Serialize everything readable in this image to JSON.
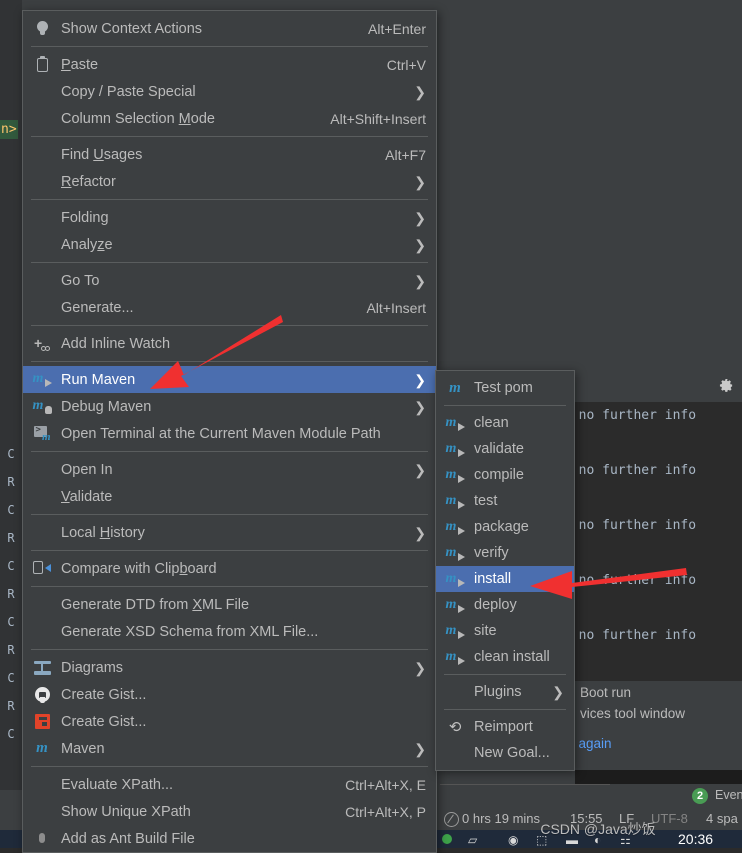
{
  "background": {
    "gutter_marks": [
      "C",
      "R",
      "C",
      "R",
      "C",
      "R",
      "C",
      "R",
      "C",
      "R",
      "C"
    ],
    "code_token": "n>",
    "console_lines": [
      ": no further info",
      ": no further info",
      ": no further info",
      ": no further info",
      ": no further info"
    ],
    "console_footer": {
      "line1": "Boot run",
      "line2": "vices tool window",
      "line3": ": again"
    },
    "gear_icon": "gear-icon"
  },
  "event_strip": {
    "badge_count": "2",
    "label": "Even"
  },
  "status_bar": {
    "clock_icon": "clock-icon",
    "elapsed": "0 hrs 19 mins",
    "time": "15:55",
    "line_separator": "LF",
    "encoding": "UTF-8",
    "indent": "4 spa"
  },
  "taskbar": {
    "clock": "20:36"
  },
  "watermark": "CSDN @Java炒饭",
  "context_menu": {
    "items": [
      {
        "type": "item",
        "label": "Show Context Actions",
        "shortcut": "Alt+Enter",
        "icon": "lightbulb-icon",
        "name": "menu-item-show-context-actions"
      },
      {
        "type": "separator"
      },
      {
        "type": "item",
        "label": "Paste",
        "mnemonic": "P",
        "shortcut": "Ctrl+V",
        "icon": "clipboard-icon",
        "name": "menu-item-paste"
      },
      {
        "type": "item",
        "label": "Copy / Paste Special",
        "submenu": true,
        "name": "menu-item-copy-paste-special"
      },
      {
        "type": "item",
        "label": "Column Selection Mode",
        "mnemonic": "M",
        "shortcut": "Alt+Shift+Insert",
        "name": "menu-item-column-selection-mode"
      },
      {
        "type": "separator"
      },
      {
        "type": "item",
        "label": "Find Usages",
        "mnemonic": "U",
        "shortcut": "Alt+F7",
        "name": "menu-item-find-usages"
      },
      {
        "type": "item",
        "label": "Refactor",
        "mnemonic": "R",
        "submenu": true,
        "name": "menu-item-refactor"
      },
      {
        "type": "separator"
      },
      {
        "type": "item",
        "label": "Folding",
        "submenu": true,
        "name": "menu-item-folding"
      },
      {
        "type": "item",
        "label": "Analyze",
        "mnemonic": "z",
        "submenu": true,
        "name": "menu-item-analyze"
      },
      {
        "type": "separator"
      },
      {
        "type": "item",
        "label": "Go To",
        "submenu": true,
        "name": "menu-item-go-to"
      },
      {
        "type": "item",
        "label": "Generate...",
        "shortcut": "Alt+Insert",
        "name": "menu-item-generate"
      },
      {
        "type": "separator"
      },
      {
        "type": "item",
        "label": "Add Inline Watch",
        "icon": "add-watch-icon",
        "name": "menu-item-add-inline-watch"
      },
      {
        "type": "separator"
      },
      {
        "type": "item",
        "label": "Run Maven",
        "submenu": true,
        "selected": true,
        "icon": "maven-run-icon",
        "name": "menu-item-run-maven"
      },
      {
        "type": "item",
        "label": "Debug Maven",
        "submenu": true,
        "icon": "maven-debug-icon",
        "name": "menu-item-debug-maven"
      },
      {
        "type": "item",
        "label": "Open Terminal at the Current Maven Module Path",
        "icon": "terminal-maven-icon",
        "name": "menu-item-open-terminal-maven"
      },
      {
        "type": "separator"
      },
      {
        "type": "item",
        "label": "Open In",
        "submenu": true,
        "name": "menu-item-open-in"
      },
      {
        "type": "item",
        "label": "Validate",
        "mnemonic": "V",
        "name": "menu-item-validate"
      },
      {
        "type": "separator"
      },
      {
        "type": "item",
        "label": "Local History",
        "mnemonic": "H",
        "submenu": true,
        "name": "menu-item-local-history"
      },
      {
        "type": "separator"
      },
      {
        "type": "item",
        "label": "Compare with Clipboard",
        "mnemonic": "b",
        "icon": "compare-clipboard-icon",
        "name": "menu-item-compare-with-clipboard"
      },
      {
        "type": "separator"
      },
      {
        "type": "item",
        "label": "Generate DTD from XML File",
        "mnemonic": "X",
        "name": "menu-item-generate-dtd"
      },
      {
        "type": "item",
        "label": "Generate XSD Schema from XML File...",
        "name": "menu-item-generate-xsd"
      },
      {
        "type": "separator"
      },
      {
        "type": "item",
        "label": "Diagrams",
        "submenu": true,
        "icon": "diagram-icon",
        "name": "menu-item-diagrams"
      },
      {
        "type": "item",
        "label": "Create Gist...",
        "icon": "github-icon",
        "name": "menu-item-create-gist-github"
      },
      {
        "type": "item",
        "label": "Create Gist...",
        "icon": "gitlab-icon",
        "name": "menu-item-create-gist-gitlab"
      },
      {
        "type": "item",
        "label": "Maven",
        "submenu": true,
        "icon": "maven-icon",
        "name": "menu-item-maven"
      },
      {
        "type": "separator"
      },
      {
        "type": "item",
        "label": "Evaluate XPath...",
        "shortcut": "Ctrl+Alt+X, E",
        "name": "menu-item-evaluate-xpath"
      },
      {
        "type": "item",
        "label": "Show Unique XPath",
        "shortcut": "Ctrl+Alt+X, P",
        "name": "menu-item-show-unique-xpath"
      },
      {
        "type": "item",
        "label": "Add as Ant Build File",
        "icon": "ant-icon",
        "name": "menu-item-add-as-ant-build-file"
      }
    ]
  },
  "maven_submenu": {
    "items": [
      {
        "type": "item",
        "label": "Test pom",
        "icon": "maven-icon",
        "name": "submenu-item-test-pom"
      },
      {
        "type": "separator"
      },
      {
        "type": "item",
        "label": "clean",
        "icon": "maven-run-icon",
        "name": "submenu-item-clean"
      },
      {
        "type": "item",
        "label": "validate",
        "icon": "maven-run-icon",
        "name": "submenu-item-validate"
      },
      {
        "type": "item",
        "label": "compile",
        "icon": "maven-run-icon",
        "name": "submenu-item-compile"
      },
      {
        "type": "item",
        "label": "test",
        "icon": "maven-run-icon",
        "name": "submenu-item-test"
      },
      {
        "type": "item",
        "label": "package",
        "icon": "maven-run-icon",
        "name": "submenu-item-package"
      },
      {
        "type": "item",
        "label": "verify",
        "icon": "maven-run-icon",
        "name": "submenu-item-verify"
      },
      {
        "type": "item",
        "label": "install",
        "icon": "maven-run-icon",
        "selected": true,
        "name": "submenu-item-install"
      },
      {
        "type": "item",
        "label": "deploy",
        "icon": "maven-run-icon",
        "name": "submenu-item-deploy"
      },
      {
        "type": "item",
        "label": "site",
        "icon": "maven-run-icon",
        "name": "submenu-item-site"
      },
      {
        "type": "item",
        "label": "clean install",
        "icon": "maven-run-icon",
        "name": "submenu-item-clean-install"
      },
      {
        "type": "separator"
      },
      {
        "type": "item",
        "label": "Plugins",
        "submenu": true,
        "name": "submenu-item-plugins"
      },
      {
        "type": "separator"
      },
      {
        "type": "item",
        "label": "Reimport",
        "icon": "reimport-icon",
        "name": "submenu-item-reimport"
      },
      {
        "type": "item",
        "label": "New Goal...",
        "name": "submenu-item-new-goal"
      }
    ]
  },
  "colors": {
    "menu_bg": "#3c3f41",
    "menu_border": "#5a5d5e",
    "selection": "#4b6eaf",
    "text": "#bbbbbb",
    "maven_blue": "#3592c4",
    "arrow_red": "#f03030",
    "editor_bg": "#2b2b2b"
  },
  "annotations": {
    "arrow1_target": "Run Maven",
    "arrow2_target": "install"
  }
}
